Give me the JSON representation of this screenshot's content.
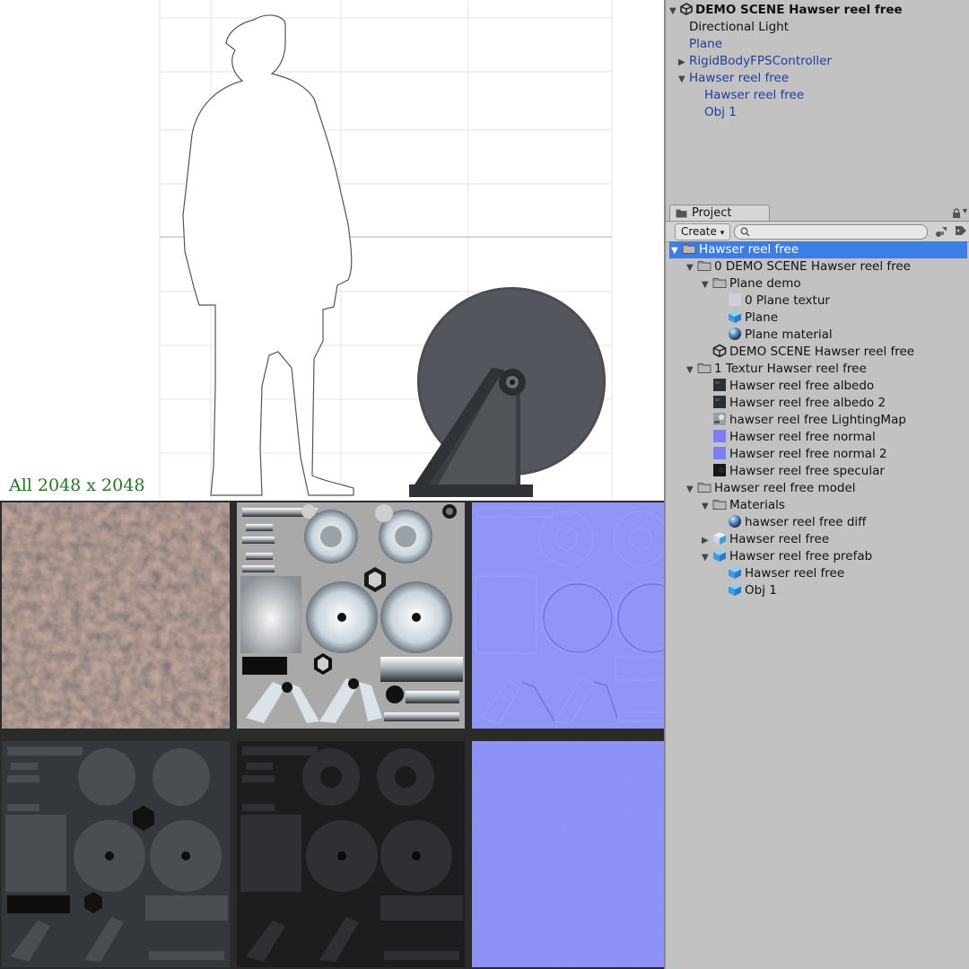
{
  "caption": "All 2048 x 2048",
  "hierarchy": {
    "scene_title": "DEMO SCENE Hawser reel free",
    "items": [
      {
        "label": "Directional Light",
        "color": "black",
        "indent": 1,
        "arrow": ""
      },
      {
        "label": "Plane",
        "color": "blue",
        "indent": 1,
        "arrow": ""
      },
      {
        "label": "RigidBodyFPSController",
        "color": "blue",
        "indent": 1,
        "arrow": "▶"
      },
      {
        "label": "Hawser reel free",
        "color": "blue",
        "indent": 1,
        "arrow": "▼"
      },
      {
        "label": "Hawser reel free",
        "color": "blue",
        "indent": 2,
        "arrow": ""
      },
      {
        "label": "Obj 1",
        "color": "blue",
        "indent": 2,
        "arrow": ""
      }
    ]
  },
  "project": {
    "tab_label": "Project",
    "create_label": "Create",
    "search_placeholder": "",
    "items": [
      {
        "label": "Hawser reel free",
        "icon": "folder",
        "indent": 0,
        "arrow": "▼",
        "selected": true
      },
      {
        "label": "0 DEMO SCENE Hawser reel free",
        "icon": "folder",
        "indent": 1,
        "arrow": "▼"
      },
      {
        "label": "Plane demo",
        "icon": "folder",
        "indent": 2,
        "arrow": "▼"
      },
      {
        "label": "0 Plane textur",
        "icon": "texture-light",
        "indent": 3,
        "arrow": ""
      },
      {
        "label": "Plane",
        "icon": "cube",
        "indent": 3,
        "arrow": ""
      },
      {
        "label": "Plane material",
        "icon": "sphere",
        "indent": 3,
        "arrow": ""
      },
      {
        "label": "DEMO SCENE Hawser reel free",
        "icon": "unity",
        "indent": 2,
        "arrow": ""
      },
      {
        "label": "1 Textur Hawser reel free",
        "icon": "folder",
        "indent": 1,
        "arrow": "▼"
      },
      {
        "label": "Hawser reel free albedo",
        "icon": "texture-dark",
        "indent": 2,
        "arrow": ""
      },
      {
        "label": "Hawser reel free albedo 2",
        "icon": "texture-dark",
        "indent": 2,
        "arrow": ""
      },
      {
        "label": "hawser reel free LightingMap",
        "icon": "texture-grey",
        "indent": 2,
        "arrow": ""
      },
      {
        "label": "Hawser reel free normal",
        "icon": "texture-normal",
        "indent": 2,
        "arrow": ""
      },
      {
        "label": "Hawser reel free normal 2",
        "icon": "texture-normal",
        "indent": 2,
        "arrow": ""
      },
      {
        "label": "Hawser reel free specular",
        "icon": "texture-black",
        "indent": 2,
        "arrow": ""
      },
      {
        "label": "Hawser reel free  model",
        "icon": "folder",
        "indent": 1,
        "arrow": "▼"
      },
      {
        "label": "Materials",
        "icon": "folder",
        "indent": 2,
        "arrow": "▼"
      },
      {
        "label": "hawser reel free diff",
        "icon": "sphere",
        "indent": 3,
        "arrow": ""
      },
      {
        "label": "Hawser reel free",
        "icon": "model",
        "indent": 2,
        "arrow": "▶"
      },
      {
        "label": "Hawser reel free prefab",
        "icon": "cube",
        "indent": 2,
        "arrow": "▼"
      },
      {
        "label": "Hawser reel free",
        "icon": "cube",
        "indent": 3,
        "arrow": ""
      },
      {
        "label": "Obj 1",
        "icon": "cube",
        "indent": 3,
        "arrow": ""
      }
    ]
  },
  "textures": [
    {
      "name": "albedo-rust"
    },
    {
      "name": "lighting-map"
    },
    {
      "name": "normal-map"
    },
    {
      "name": "albedo-dark"
    },
    {
      "name": "specular"
    },
    {
      "name": "normal-map-flat"
    }
  ],
  "colors": {
    "normal": "#7b7ff5",
    "selection": "#3d7ee6",
    "panel": "#c2c2c2",
    "caption": "#1e7a1e",
    "hierarchy_blue": "#1f3c9a"
  }
}
